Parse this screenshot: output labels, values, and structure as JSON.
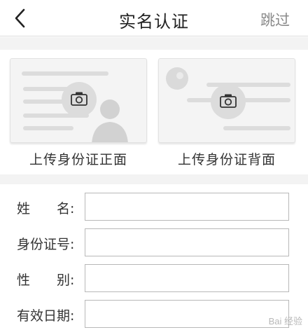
{
  "header": {
    "title": "实名认证",
    "skip_label": "跳过"
  },
  "upload": {
    "front_label": "上传身份证正面",
    "back_label": "上传身份证背面"
  },
  "form": {
    "name_label_a": "姓",
    "name_label_b": "名:",
    "id_label": "身份证号:",
    "gender_label_a": "性",
    "gender_label_b": "别:",
    "expiry_label": "有效日期:",
    "name_value": "",
    "id_value": "",
    "gender_value": "",
    "expiry_value": ""
  },
  "icons": {
    "back": "chevron-left-icon",
    "camera": "camera-icon"
  },
  "colors": {
    "divider": "#f3f3f3",
    "skip_text": "#8a8a8a",
    "input_border": "#b8b8b8"
  },
  "watermark": "Bai 经验"
}
